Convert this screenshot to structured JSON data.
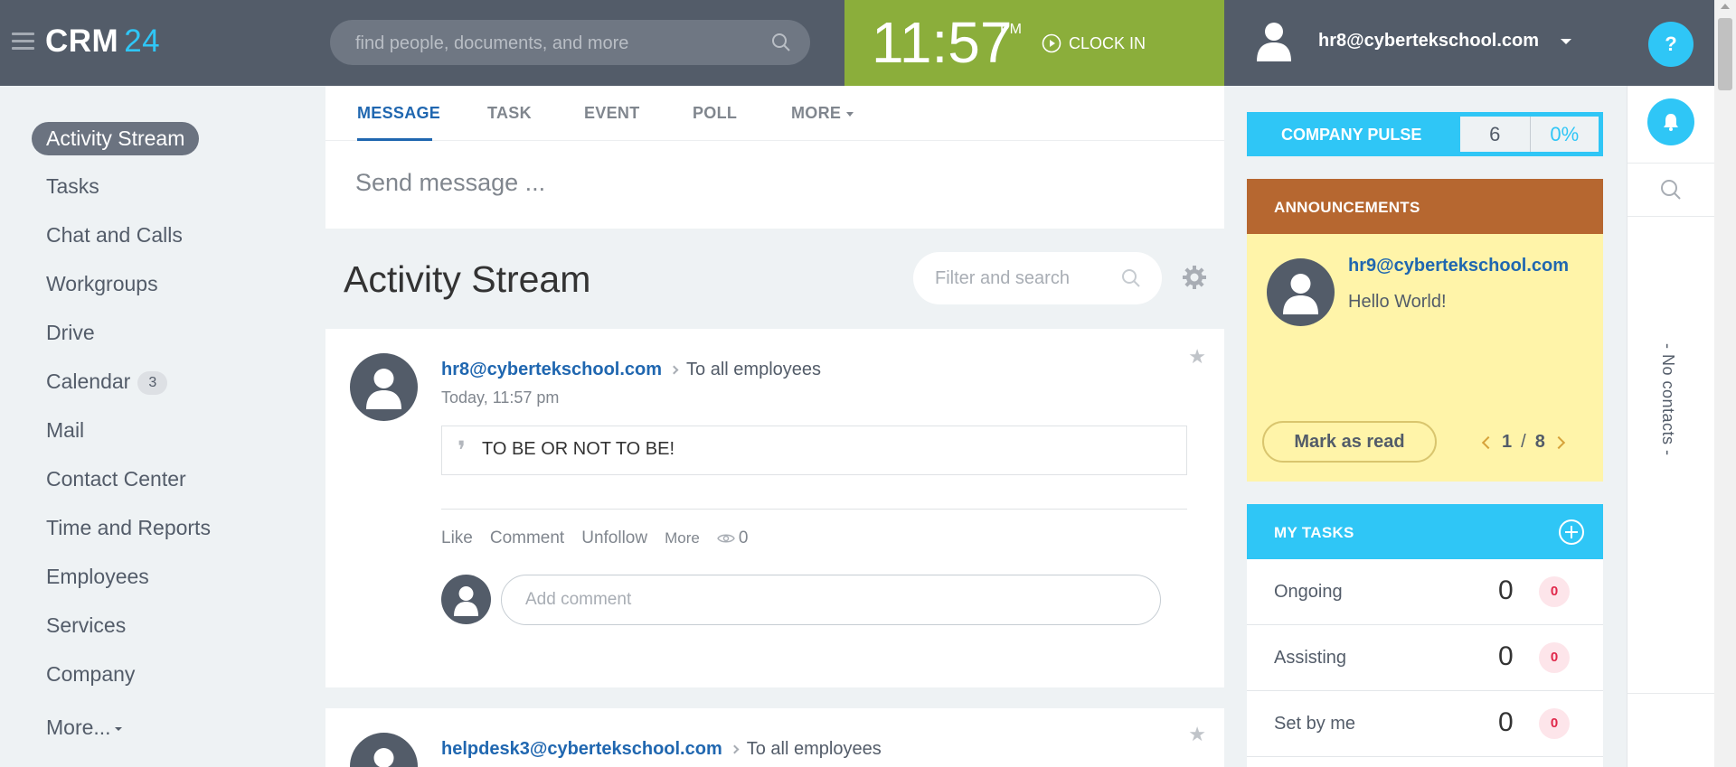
{
  "header": {
    "logo_main": "CRM",
    "logo_num": "24",
    "search_placeholder": "find people, documents, and more",
    "time": "11:57",
    "ampm": "PM",
    "clock_in": "CLOCK IN",
    "user_email": "hr8@cybertekschool.com",
    "help": "?"
  },
  "nav": {
    "active": "Activity Stream",
    "items": [
      {
        "label": "Tasks"
      },
      {
        "label": "Chat and Calls"
      },
      {
        "label": "Workgroups"
      },
      {
        "label": "Drive"
      },
      {
        "label": "Calendar",
        "badge": "3"
      },
      {
        "label": "Mail"
      },
      {
        "label": "Contact Center"
      },
      {
        "label": "Time and Reports"
      },
      {
        "label": "Employees"
      },
      {
        "label": "Services"
      },
      {
        "label": "Company"
      },
      {
        "label": "More..."
      }
    ]
  },
  "composer": {
    "tabs": [
      "MESSAGE",
      "TASK",
      "EVENT",
      "POLL",
      "MORE"
    ],
    "active_tab": "MESSAGE",
    "placeholder": "Send message ..."
  },
  "stream": {
    "title": "Activity Stream",
    "filter_placeholder": "Filter and search"
  },
  "posts": [
    {
      "author": "hr8@cybertekschool.com",
      "destination": "To all employees",
      "date": "Today, 11:57 pm",
      "quote": "TO BE OR NOT TO BE!",
      "actions": [
        "Like",
        "Comment",
        "Unfollow",
        "More"
      ],
      "views": "0",
      "comment_placeholder": "Add comment"
    },
    {
      "author": "helpdesk3@cybertekschool.com",
      "destination": "To all employees"
    }
  ],
  "pulse": {
    "label": "COMPANY PULSE",
    "value": "6",
    "percent": "0%"
  },
  "announcements": {
    "title": "ANNOUNCEMENTS",
    "author": "hr9@cybertekschool.com",
    "text": "Hello World!",
    "mark_read": "Mark as read",
    "page_current": "1",
    "page_sep": "/",
    "page_total": "8"
  },
  "tasks": {
    "title": "MY TASKS",
    "rows": [
      {
        "label": "Ongoing",
        "count": "0",
        "badge": "0"
      },
      {
        "label": "Assisting",
        "count": "0",
        "badge": "0"
      },
      {
        "label": "Set by me",
        "count": "0",
        "badge": "0"
      }
    ]
  },
  "rail": {
    "no_contacts": "- No contacts -"
  },
  "colors": {
    "header_bg": "#535c69",
    "accent_blue": "#2fc6f6",
    "clock_green": "#8bae3b",
    "announcement_orange": "#b66730",
    "announcement_yellow": "#fff4a9",
    "link_blue": "#2067b0"
  }
}
